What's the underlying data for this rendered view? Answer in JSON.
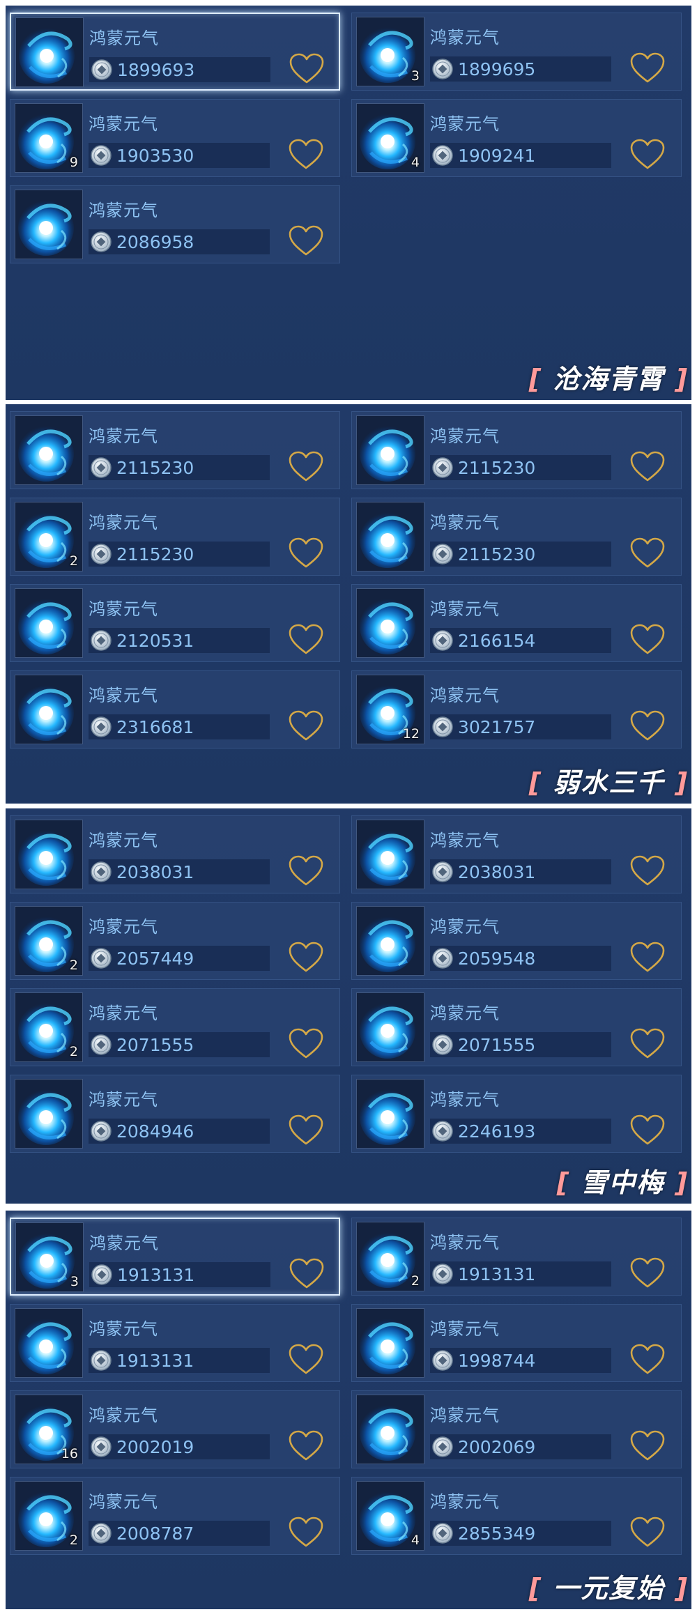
{
  "item_name": "鸿蒙元气",
  "colors": {
    "panel": "#213a68",
    "text": "#8ec2f2",
    "heart": "#d4a847",
    "selected": "#dfeeff"
  },
  "icons": {
    "item": "nebula-orb-icon",
    "currency": "coin-icon",
    "favorite": "heart-icon"
  },
  "sections": [
    {
      "tag": "沧海青霄",
      "listings": [
        {
          "price": "1899693",
          "qty": "",
          "selected": true
        },
        {
          "price": "1899695",
          "qty": "3"
        },
        {
          "price": "1903530",
          "qty": "9"
        },
        {
          "price": "1909241",
          "qty": "4"
        },
        {
          "price": "2086958",
          "qty": ""
        }
      ]
    },
    {
      "tag": "弱水三千",
      "listings": [
        {
          "price": "2115230",
          "qty": ""
        },
        {
          "price": "2115230",
          "qty": ""
        },
        {
          "price": "2115230",
          "qty": "2"
        },
        {
          "price": "2115230",
          "qty": ""
        },
        {
          "price": "2120531",
          "qty": ""
        },
        {
          "price": "2166154",
          "qty": ""
        },
        {
          "price": "2316681",
          "qty": ""
        },
        {
          "price": "3021757",
          "qty": "12"
        }
      ]
    },
    {
      "tag": "雪中梅",
      "listings": [
        {
          "price": "2038031",
          "qty": ""
        },
        {
          "price": "2038031",
          "qty": ""
        },
        {
          "price": "2057449",
          "qty": "2"
        },
        {
          "price": "2059548",
          "qty": ""
        },
        {
          "price": "2071555",
          "qty": "2"
        },
        {
          "price": "2071555",
          "qty": ""
        },
        {
          "price": "2084946",
          "qty": ""
        },
        {
          "price": "2246193",
          "qty": ""
        }
      ]
    },
    {
      "tag": "一元复始",
      "listings": [
        {
          "price": "1913131",
          "qty": "3",
          "selected": true
        },
        {
          "price": "1913131",
          "qty": "2"
        },
        {
          "price": "1913131",
          "qty": ""
        },
        {
          "price": "1998744",
          "qty": ""
        },
        {
          "price": "2002019",
          "qty": "16"
        },
        {
          "price": "2002069",
          "qty": ""
        },
        {
          "price": "2008787",
          "qty": "2"
        },
        {
          "price": "2855349",
          "qty": "4"
        }
      ]
    }
  ]
}
